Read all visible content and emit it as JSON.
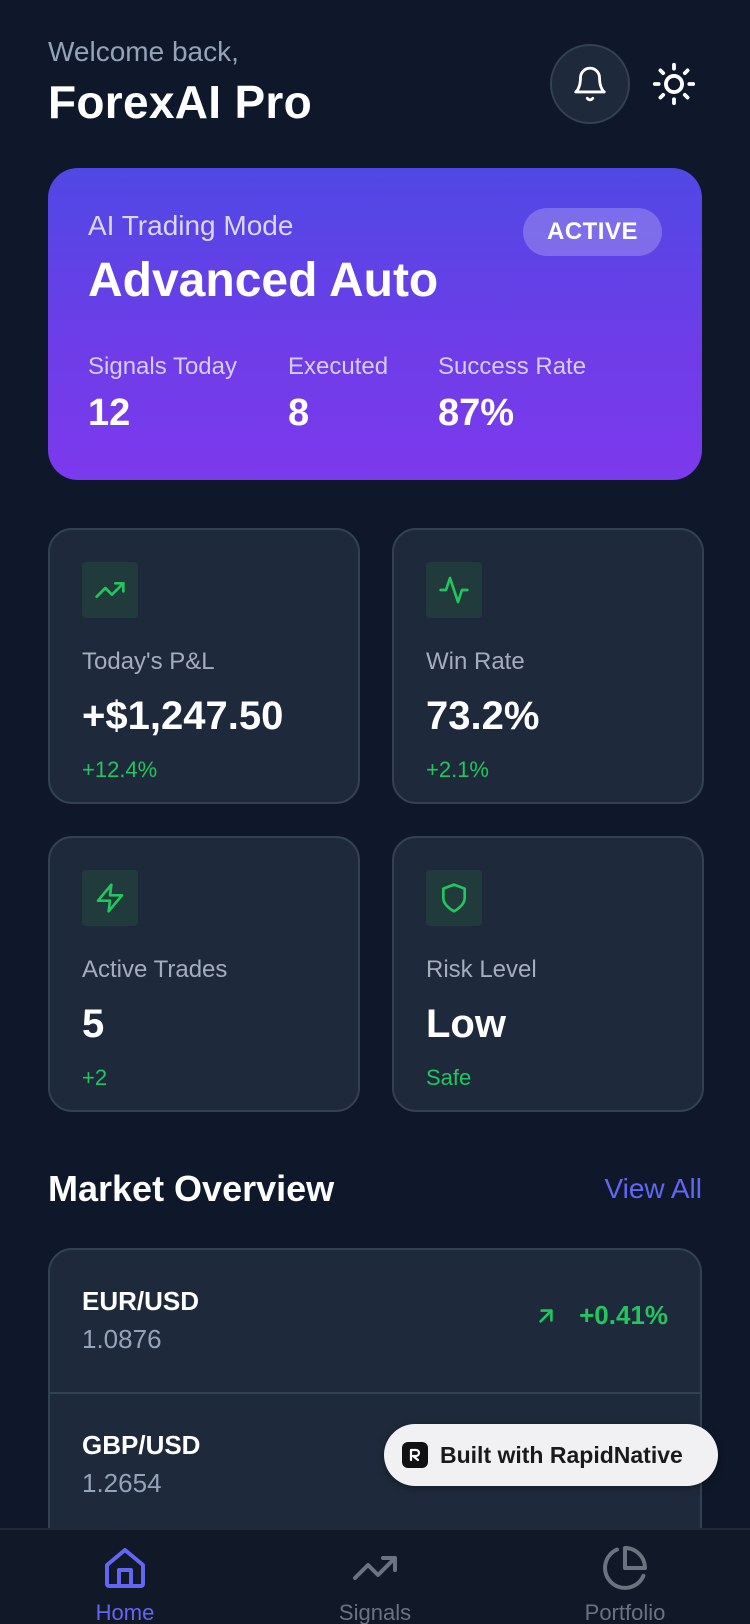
{
  "header": {
    "welcome": "Welcome back,",
    "title": "ForexAI Pro",
    "bell_icon": "bell-icon",
    "theme_icon": "sun-icon"
  },
  "mode_card": {
    "label": "AI Trading Mode",
    "name": "Advanced Auto",
    "badge": "ACTIVE",
    "stats": [
      {
        "label": "Signals Today",
        "value": "12"
      },
      {
        "label": "Executed",
        "value": "8"
      },
      {
        "label": "Success Rate",
        "value": "87%"
      }
    ]
  },
  "stats": [
    {
      "icon": "trending-up-icon",
      "label": "Today's P&L",
      "value": "+$1,247.50",
      "change": "+12.4%"
    },
    {
      "icon": "activity-icon",
      "label": "Win Rate",
      "value": "73.2%",
      "change": "+2.1%"
    },
    {
      "icon": "zap-icon",
      "label": "Active Trades",
      "value": "5",
      "change": "+2"
    },
    {
      "icon": "shield-icon",
      "label": "Risk Level",
      "value": "Low",
      "change": "Safe"
    }
  ],
  "market": {
    "title": "Market Overview",
    "view_all": "View All",
    "rows": [
      {
        "pair": "EUR/USD",
        "price": "1.0876",
        "change": "+0.41%"
      },
      {
        "pair": "GBP/USD",
        "price": "1.2654",
        "change": ""
      }
    ]
  },
  "badge": {
    "text": "Built with RapidNative"
  },
  "tabs": [
    {
      "label": "Home",
      "icon": "home-icon",
      "active": true
    },
    {
      "label": "Signals",
      "icon": "trending-up-icon",
      "active": false
    },
    {
      "label": "Portfolio",
      "icon": "pie-chart-icon",
      "active": false
    }
  ],
  "colors": {
    "background": "#0f172a",
    "card": "#1e293b",
    "accent": "#6366f1",
    "positive": "#22c55e"
  }
}
